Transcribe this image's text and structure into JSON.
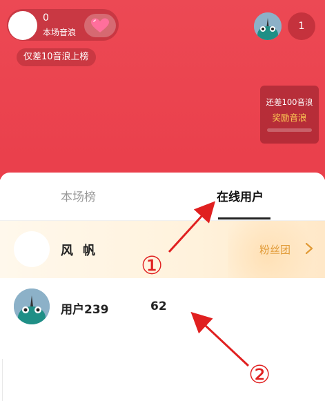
{
  "host": {
    "count": "0",
    "caption": "本场音浪"
  },
  "rank_notice": "仅差10音浪上榜",
  "viewer_count": "1",
  "reward": {
    "line1": "还差100音浪",
    "line2": "奖励音浪"
  },
  "tabs": [
    {
      "label": "本场榜",
      "active": false
    },
    {
      "label": "在线用户",
      "active": true
    }
  ],
  "fan_row": {
    "name": "风帆",
    "club_label": "粉丝团"
  },
  "user_row": {
    "name": "用户239",
    "score": "62"
  },
  "annotations": [
    {
      "label": "①"
    },
    {
      "label": "②"
    }
  ],
  "colors": {
    "room_background": "#ea3f4b",
    "annotation_red": "#e02020",
    "club_gold": "#e19a36",
    "reward_gold": "#ffcf55"
  },
  "icons": {
    "heart": "heart-icon",
    "chevron": "chevron-right-icon",
    "avatar": "teal-monster-avatar"
  }
}
